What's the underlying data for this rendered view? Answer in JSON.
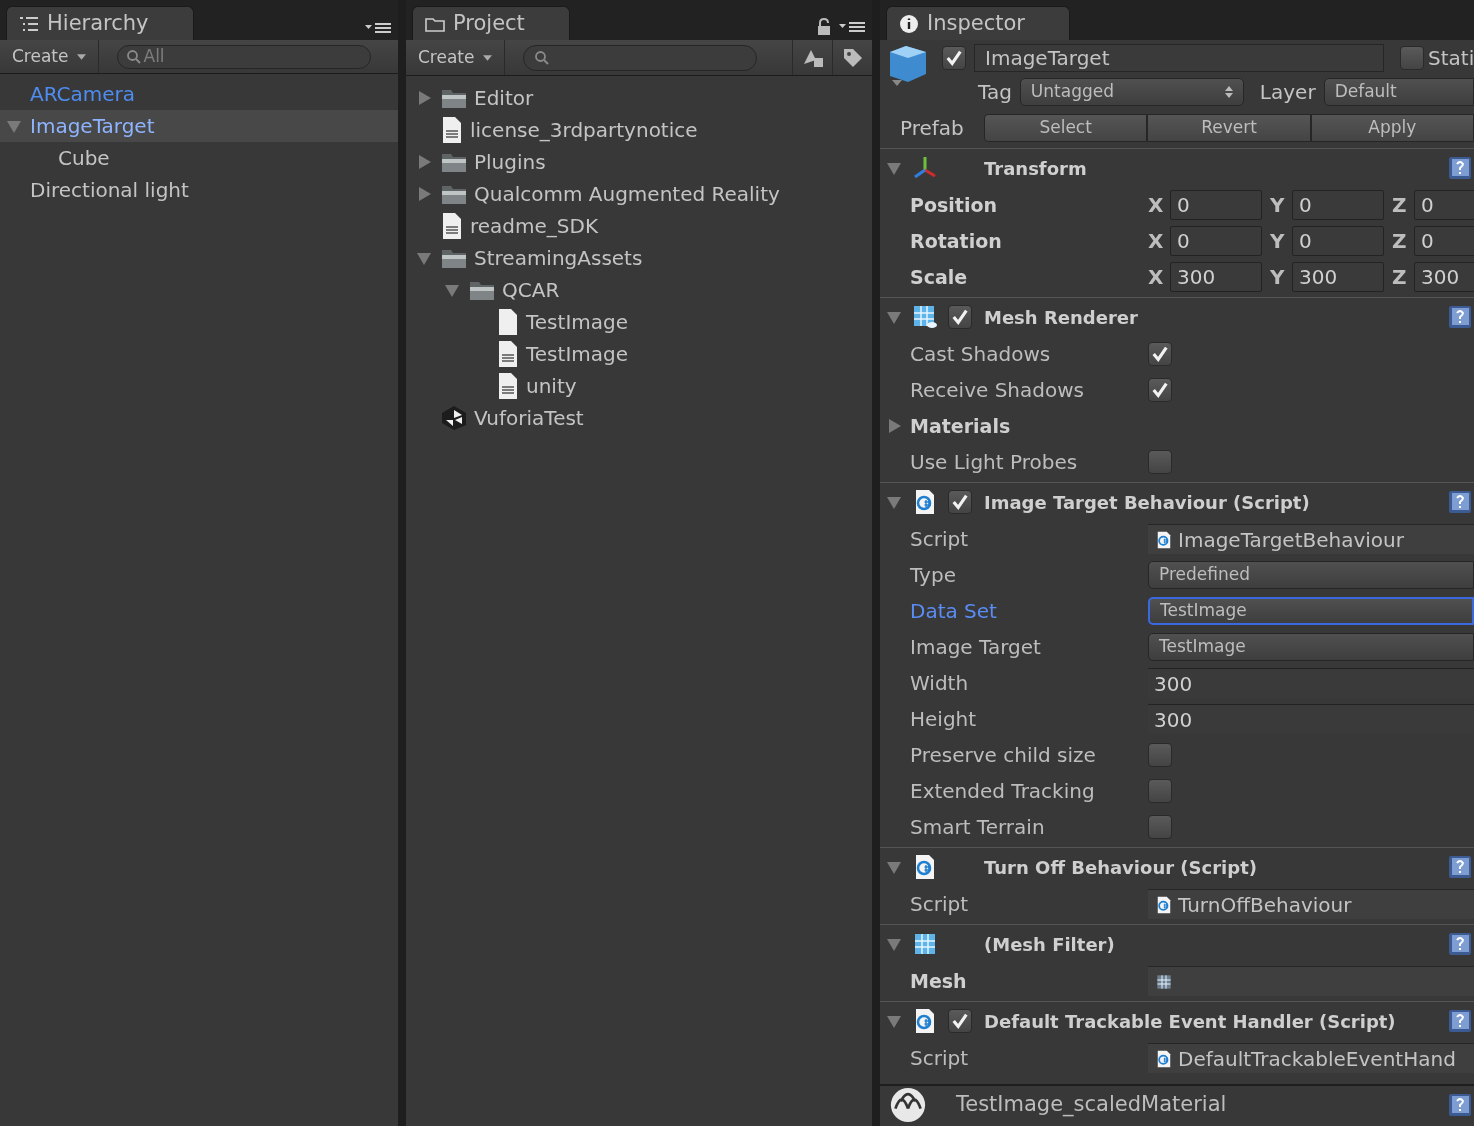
{
  "hierarchy": {
    "tab": "Hierarchy",
    "create": "Create",
    "search_placeholder": "All",
    "items": [
      {
        "name": "ARCamera",
        "prefab": true,
        "selected": false
      },
      {
        "name": "ImageTarget",
        "prefab": true,
        "selected": true,
        "expanded": true,
        "children": [
          {
            "name": "Cube",
            "prefab": false,
            "selected": false
          }
        ]
      },
      {
        "name": "Directional light",
        "prefab": false,
        "selected": false
      }
    ]
  },
  "project": {
    "tab": "Project",
    "create": "Create",
    "items": [
      {
        "name": "Editor",
        "kind": "folder",
        "expanded": false
      },
      {
        "name": "license_3rdpartynotice",
        "kind": "doc"
      },
      {
        "name": "Plugins",
        "kind": "folder",
        "expanded": false
      },
      {
        "name": "Qualcomm Augmented Reality",
        "kind": "folder",
        "expanded": false
      },
      {
        "name": "readme_SDK",
        "kind": "doc"
      },
      {
        "name": "StreamingAssets",
        "kind": "folder",
        "expanded": true,
        "children": [
          {
            "name": "QCAR",
            "kind": "folder",
            "expanded": true,
            "children": [
              {
                "name": "TestImage",
                "kind": "blank"
              },
              {
                "name": "TestImage",
                "kind": "doc"
              },
              {
                "name": "unity",
                "kind": "doc"
              }
            ]
          }
        ]
      },
      {
        "name": "VuforiaTest",
        "kind": "scene"
      }
    ]
  },
  "inspector": {
    "tab": "Inspector",
    "object": {
      "active": true,
      "name": "ImageTarget",
      "static_label": "Stati",
      "static": false,
      "tag_label": "Tag",
      "tag": "Untagged",
      "layer_label": "Layer",
      "layer": "Default",
      "prefab_label": "Prefab",
      "prefab_buttons": [
        "Select",
        "Revert",
        "Apply"
      ]
    },
    "components": [
      {
        "kind": "transform",
        "title": "Transform",
        "expanded": true,
        "rows": [
          {
            "kind": "vector",
            "label": "Position",
            "modified": true,
            "fields": [
              {
                "axis": "X",
                "value": "0"
              },
              {
                "axis": "Y",
                "value": "0"
              },
              {
                "axis": "Z",
                "value": "0"
              }
            ]
          },
          {
            "kind": "vector",
            "label": "Rotation",
            "modified": true,
            "fields": [
              {
                "axis": "X",
                "value": "0"
              },
              {
                "axis": "Y",
                "value": "0"
              },
              {
                "axis": "Z",
                "value": "0"
              }
            ]
          },
          {
            "kind": "vector",
            "label": "Scale",
            "modified": true,
            "fields": [
              {
                "axis": "X",
                "value": "300"
              },
              {
                "axis": "Y",
                "value": "300"
              },
              {
                "axis": "Z",
                "value": "300"
              }
            ]
          }
        ]
      },
      {
        "kind": "mesh-renderer",
        "enabled": true,
        "title": "Mesh Renderer",
        "expanded": true,
        "rows": [
          {
            "kind": "checkbox",
            "label": "Cast Shadows",
            "modified": false,
            "checked": true
          },
          {
            "kind": "checkbox",
            "label": "Receive Shadows",
            "modified": false,
            "checked": true
          },
          {
            "kind": "foldout",
            "label": "Materials",
            "modified": true,
            "expanded": false
          },
          {
            "kind": "checkbox",
            "label": "Use Light Probes",
            "modified": false,
            "checked": false
          }
        ]
      },
      {
        "kind": "script",
        "enabled": true,
        "title": "Image Target Behaviour (Script)",
        "expanded": true,
        "rows": [
          {
            "kind": "script-ref",
            "label": "Script",
            "modified": false,
            "value": "ImageTargetBehaviour"
          },
          {
            "kind": "dropdown",
            "label": "Type",
            "modified": false,
            "focused": false,
            "value": "Predefined"
          },
          {
            "kind": "dropdown",
            "label": "Data Set",
            "modified": false,
            "focused": true,
            "value": "TestImage"
          },
          {
            "kind": "dropdown",
            "label": "Image Target",
            "modified": false,
            "focused": false,
            "value": "TestImage"
          },
          {
            "kind": "number",
            "label": "Width",
            "modified": false,
            "value": "300"
          },
          {
            "kind": "number",
            "label": "Height",
            "modified": false,
            "value": "300"
          },
          {
            "kind": "checkbox",
            "label": "Preserve child size",
            "modified": false,
            "checked": false
          },
          {
            "kind": "checkbox",
            "label": "Extended Tracking",
            "modified": false,
            "checked": false
          },
          {
            "kind": "checkbox",
            "label": "Smart Terrain",
            "modified": false,
            "checked": false
          }
        ]
      },
      {
        "kind": "script",
        "title": "Turn Off Behaviour (Script)",
        "expanded": true,
        "rows": [
          {
            "kind": "script-ref",
            "label": "Script",
            "modified": false,
            "value": "TurnOffBehaviour"
          }
        ]
      },
      {
        "kind": "mesh-filter",
        "title": "(Mesh Filter)",
        "expanded": true,
        "rows": [
          {
            "kind": "mesh-ref",
            "label": "Mesh",
            "modified": true
          }
        ]
      },
      {
        "kind": "script",
        "enabled": true,
        "title": "Default Trackable Event Handler (Script)",
        "expanded": true,
        "rows": [
          {
            "kind": "script-ref",
            "label": "Script",
            "modified": false,
            "value": "DefaultTrackableEventHand"
          }
        ]
      }
    ],
    "material": {
      "title": "TestImage_scaledMaterial"
    }
  }
}
